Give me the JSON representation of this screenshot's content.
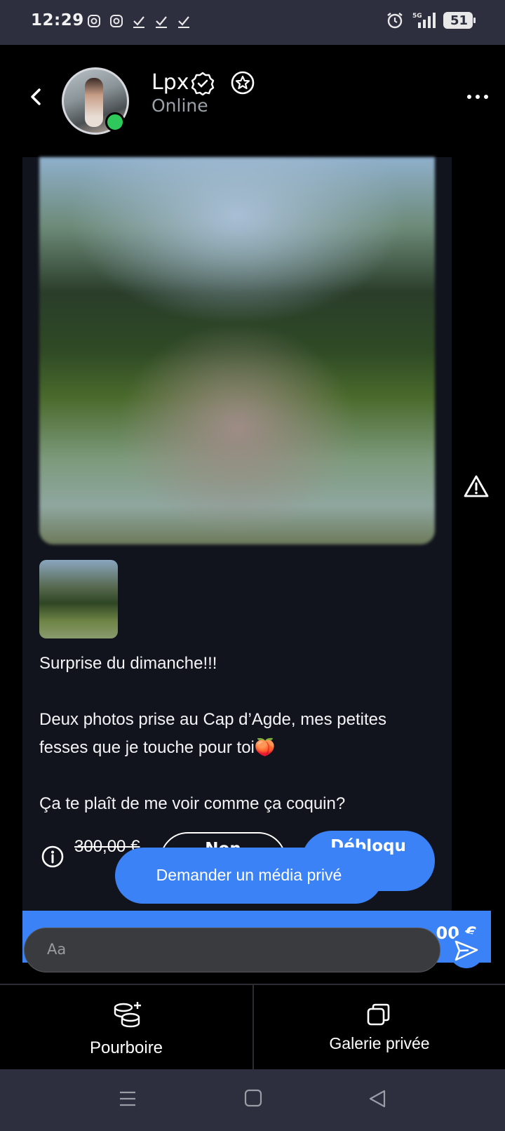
{
  "status_bar": {
    "time": "12:29",
    "left_icons": [
      "instagram-icon",
      "instagram-icon",
      "check-icon",
      "check-icon",
      "check-icon"
    ],
    "right_icons": [
      "alarm-icon",
      "signal-5g-icon"
    ],
    "battery": "51"
  },
  "header": {
    "user_name": "Lpx",
    "status": "Online",
    "icons": [
      "back-icon",
      "verified-icon",
      "star-icon",
      "more-icon"
    ]
  },
  "message": {
    "text": "Surprise du dimanche!!!\n\nDeux photos prise au Cap d’Agde, mes petites fesses que je touche pour toi🍑\n\nÇa te plaît de me voir comme ça coquin?",
    "old_price": "300,00 €",
    "btn_no": "Non",
    "btn_unlock": "Débloqu"
  },
  "request_media": "Demander un média privé",
  "strip_price": "00 €",
  "composer": {
    "placeholder": "Aa"
  },
  "bottom_actions": {
    "tip": "Pourboire",
    "gallery": "Galerie privée"
  },
  "colors": {
    "accent": "#3b82f6",
    "online": "#2fc85a",
    "card_bg": "#11141d",
    "system_bar": "#2d2f3f"
  }
}
